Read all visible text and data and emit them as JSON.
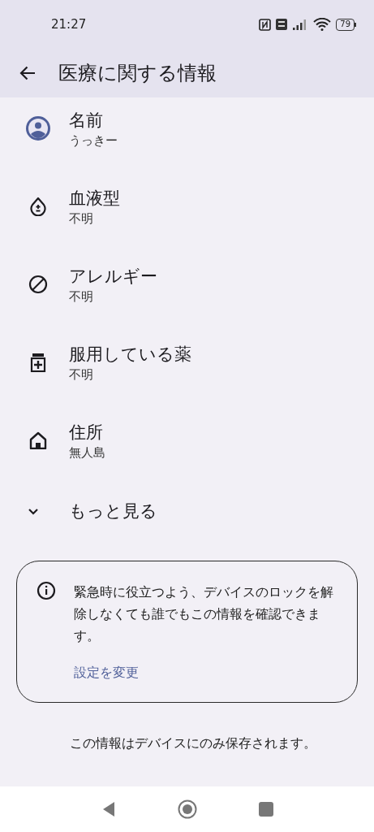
{
  "status_bar": {
    "time": "21:27",
    "battery": "79"
  },
  "app_bar": {
    "title": "医療に関する情報"
  },
  "items": [
    {
      "kind": "person",
      "title": "名前",
      "value": "うっきー"
    },
    {
      "kind": "blood",
      "title": "血液型",
      "value": "不明"
    },
    {
      "kind": "allergy",
      "title": "アレルギー",
      "value": "不明"
    },
    {
      "kind": "medicine",
      "title": "服用している薬",
      "value": "不明"
    },
    {
      "kind": "home",
      "title": "住所",
      "value": "無人島"
    }
  ],
  "more": {
    "label": "もっと見る"
  },
  "notice": {
    "text": "緊急時に役立つよう、デバイスのロックを解除しなくても誰でもこの情報を確認できます。",
    "link": "設定を変更"
  },
  "footer": "この情報はデバイスにのみ保存されます。"
}
